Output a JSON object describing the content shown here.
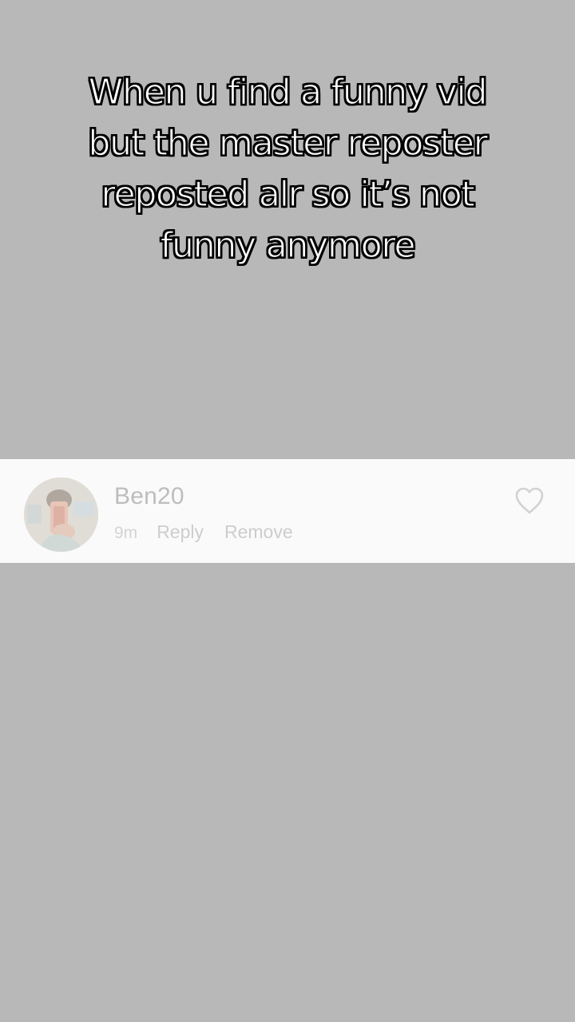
{
  "caption": {
    "lines": [
      "When u find a funny vid",
      "but the master reposter",
      "reposted alr so it’s not",
      "funny anymore"
    ]
  },
  "comment": {
    "username": "Ben20",
    "time": "9m",
    "reply_label": "Reply",
    "remove_label": "Remove",
    "like_icon": "heart-outline-icon"
  },
  "colors": {
    "background": "#b8b8b8",
    "card": "#fafafa",
    "muted_text": "#c8c8c8"
  }
}
